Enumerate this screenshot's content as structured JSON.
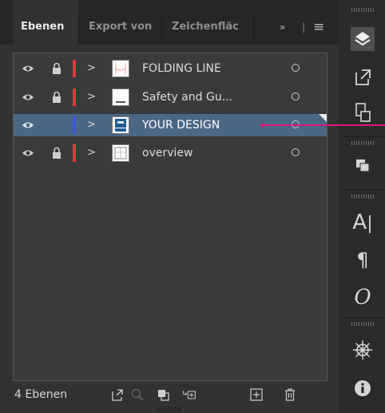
{
  "tabs": {
    "layers": "Ebenen",
    "export": "Export von",
    "artboards": "Zeichenfläc",
    "overflow": "»",
    "menu": "≡"
  },
  "layers": [
    {
      "name": "FOLDING LINE",
      "color": "#e03a3a",
      "visible": true,
      "locked": true,
      "selected": false
    },
    {
      "name": "Safety and Gu...",
      "color": "#e03a3a",
      "visible": true,
      "locked": true,
      "selected": false
    },
    {
      "name": "YOUR DESIGN",
      "color": "#3b57d6",
      "visible": true,
      "locked": false,
      "selected": true
    },
    {
      "name": "overview",
      "color": "#e03a3a",
      "visible": true,
      "locked": true,
      "selected": false
    }
  ],
  "footer": {
    "count": "4 Ebenen"
  },
  "annotation_color": "#d6197c",
  "right_rail_icons": [
    "layers-icon",
    "export-icon",
    "artboards-icon",
    "pathfinder-icon",
    "character-icon",
    "paragraph-icon",
    "opentype-icon",
    "symbols-icon",
    "info-icon"
  ]
}
